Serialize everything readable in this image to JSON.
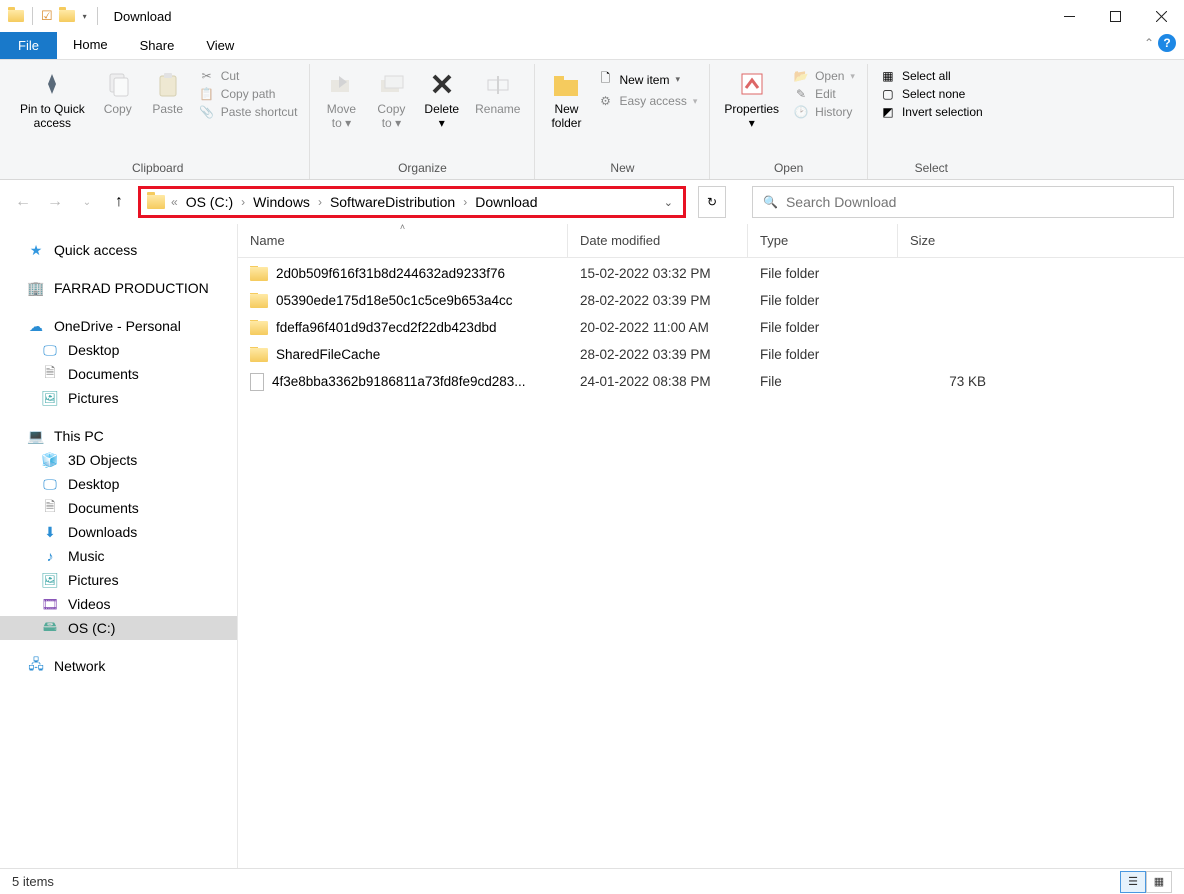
{
  "window": {
    "title": "Download"
  },
  "qat": {
    "check_icon": "✔"
  },
  "menubar": {
    "file": "File",
    "home": "Home",
    "share": "Share",
    "view": "View"
  },
  "ribbon": {
    "clipboard": {
      "label": "Clipboard",
      "pin": "Pin to Quick\naccess",
      "copy": "Copy",
      "paste": "Paste",
      "cut": "Cut",
      "copy_path": "Copy path",
      "paste_shortcut": "Paste shortcut"
    },
    "organize": {
      "label": "Organize",
      "move_to": "Move\nto",
      "copy_to": "Copy\nto",
      "delete": "Delete",
      "rename": "Rename"
    },
    "new": {
      "label": "New",
      "new_folder": "New\nfolder",
      "new_item": "New item",
      "easy_access": "Easy access"
    },
    "open": {
      "label": "Open",
      "properties": "Properties",
      "open": "Open",
      "edit": "Edit",
      "history": "History"
    },
    "select": {
      "label": "Select",
      "select_all": "Select all",
      "select_none": "Select none",
      "invert": "Invert selection"
    }
  },
  "breadcrumb": {
    "parts": [
      "OS (C:)",
      "Windows",
      "SoftwareDistribution",
      "Download"
    ]
  },
  "search": {
    "placeholder": "Search Download"
  },
  "sidebar": {
    "quick_access": "Quick access",
    "farrad": "FARRAD PRODUCTION",
    "onedrive": "OneDrive - Personal",
    "od_desktop": "Desktop",
    "od_documents": "Documents",
    "od_pictures": "Pictures",
    "this_pc": "This PC",
    "pc_3d": "3D Objects",
    "pc_desktop": "Desktop",
    "pc_documents": "Documents",
    "pc_downloads": "Downloads",
    "pc_music": "Music",
    "pc_pictures": "Pictures",
    "pc_videos": "Videos",
    "pc_os": "OS (C:)",
    "network": "Network"
  },
  "columns": {
    "name": "Name",
    "date": "Date modified",
    "type": "Type",
    "size": "Size"
  },
  "files": [
    {
      "icon": "folder",
      "name": "2d0b509f616f31b8d244632ad9233f76",
      "date": "15-02-2022 03:32 PM",
      "type": "File folder",
      "size": ""
    },
    {
      "icon": "folder",
      "name": "05390ede175d18e50c1c5ce9b653a4cc",
      "date": "28-02-2022 03:39 PM",
      "type": "File folder",
      "size": ""
    },
    {
      "icon": "folder",
      "name": "fdeffa96f401d9d37ecd2f22db423dbd",
      "date": "20-02-2022 11:00 AM",
      "type": "File folder",
      "size": ""
    },
    {
      "icon": "folder",
      "name": "SharedFileCache",
      "date": "28-02-2022 03:39 PM",
      "type": "File folder",
      "size": ""
    },
    {
      "icon": "file",
      "name": "4f3e8bba3362b9186811a73fd8fe9cd283...",
      "date": "24-01-2022 08:38 PM",
      "type": "File",
      "size": "73 KB"
    }
  ],
  "status": {
    "count": "5 items"
  }
}
